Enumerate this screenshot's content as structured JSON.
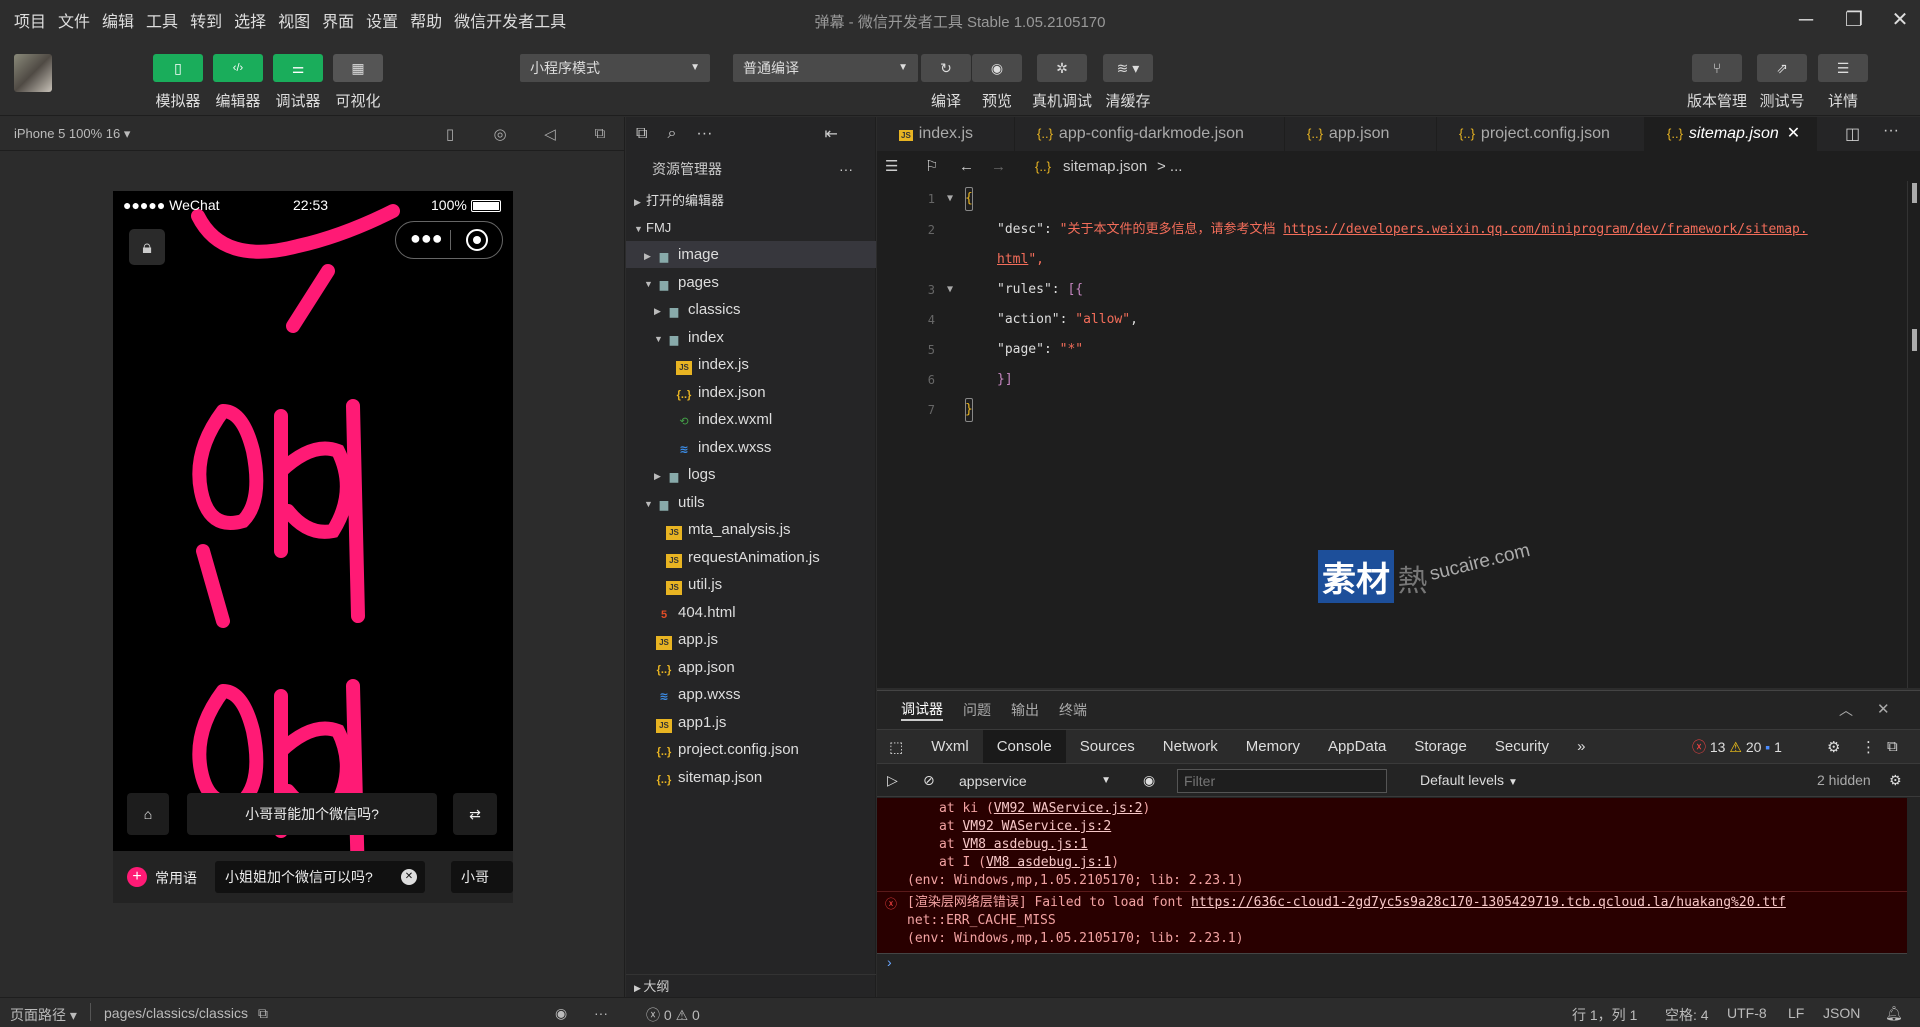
{
  "menubar": {
    "items": [
      "项目",
      "文件",
      "编辑",
      "工具",
      "转到",
      "选择",
      "视图",
      "界面",
      "设置",
      "帮助",
      "微信开发者工具"
    ],
    "window_title": "弹幕 - 微信开发者工具 Stable 1.05.2105170"
  },
  "toolbar": {
    "simulator_label": "模拟器",
    "editor_label": "编辑器",
    "debugger_label": "调试器",
    "visual_label": "可视化",
    "mode_select": "小程序模式",
    "compile_select": "普通编译",
    "compile_label": "编译",
    "preview_label": "预览",
    "remote_debug_label": "真机调试",
    "clear_cache_label": "清缓存",
    "version_label": "版本管理",
    "test_label": "测试号",
    "details_label": "详情"
  },
  "simulator": {
    "device": "iPhone 5 100% 16 ▾",
    "status_carrier": "●●●●● WeChat",
    "status_time": "22:53",
    "status_battery": "100%",
    "input_bar_text": "小哥哥能加个微信吗?",
    "quick_label": "常用语",
    "chip1": "小姐姐加个微信可以吗?",
    "chip2": "小哥",
    "danmaku_color": "#ff1a75"
  },
  "explorer": {
    "title": "资源管理器",
    "open_editors": "打开的编辑器",
    "project": "FMJ",
    "tree": [
      {
        "name": "image",
        "type": "folder",
        "depth": 1,
        "arrow": "▶"
      },
      {
        "name": "pages",
        "type": "folder",
        "depth": 1,
        "arrow": "▼"
      },
      {
        "name": "classics",
        "type": "folder",
        "depth": 2,
        "arrow": "▶"
      },
      {
        "name": "index",
        "type": "folder",
        "depth": 2,
        "arrow": "▼"
      },
      {
        "name": "index.js",
        "type": "js",
        "depth": 3,
        "arrow": ""
      },
      {
        "name": "index.json",
        "type": "json",
        "depth": 3,
        "arrow": ""
      },
      {
        "name": "index.wxml",
        "type": "wxml",
        "depth": 3,
        "arrow": ""
      },
      {
        "name": "index.wxss",
        "type": "wxss",
        "depth": 3,
        "arrow": ""
      },
      {
        "name": "logs",
        "type": "folder",
        "depth": 2,
        "arrow": "▶"
      },
      {
        "name": "utils",
        "type": "folder",
        "depth": 1,
        "arrow": "▼"
      },
      {
        "name": "mta_analysis.js",
        "type": "js",
        "depth": 2,
        "arrow": ""
      },
      {
        "name": "requestAnimation.js",
        "type": "js",
        "depth": 2,
        "arrow": ""
      },
      {
        "name": "util.js",
        "type": "js",
        "depth": 2,
        "arrow": ""
      },
      {
        "name": "404.html",
        "type": "html",
        "depth": 1,
        "arrow": ""
      },
      {
        "name": "app.js",
        "type": "js",
        "depth": 1,
        "arrow": ""
      },
      {
        "name": "app.json",
        "type": "json",
        "depth": 1,
        "arrow": ""
      },
      {
        "name": "app.wxss",
        "type": "wxss",
        "depth": 1,
        "arrow": ""
      },
      {
        "name": "app1.js",
        "type": "js",
        "depth": 1,
        "arrow": ""
      },
      {
        "name": "project.config.json",
        "type": "json",
        "depth": 1,
        "arrow": ""
      },
      {
        "name": "sitemap.json",
        "type": "json",
        "depth": 1,
        "arrow": ""
      }
    ],
    "outline": "大纲",
    "problems": "ⓧ 0 ⚠ 0"
  },
  "editor": {
    "tabs": [
      {
        "name": "index.js",
        "icon": "JS"
      },
      {
        "name": "app-config-darkmode.json",
        "icon": "{..}"
      },
      {
        "name": "app.json",
        "icon": "{..}"
      },
      {
        "name": "project.config.json",
        "icon": "{..}"
      },
      {
        "name": "sitemap.json",
        "icon": "{..}"
      }
    ],
    "breadcrumb_file": "sitemap.json",
    "breadcrumb_rest": "> ...",
    "lines": {
      "l1": "{",
      "l2_key": "\"desc\"",
      "l2_str": "\"关于本文件的更多信息，请参考文档 ",
      "l2_url": "https://developers.weixin.qq.com/miniprogram/dev/framework/sitemap.",
      "l2b_url": "html",
      "l2b_end": "\",",
      "l3_key": "\"rules\"",
      "l3_open": "[{",
      "l4_key": "\"action\"",
      "l4_val": "\"allow\"",
      "l5_key": "\"page\"",
      "l5_val": "\"*\"",
      "l6": "}]",
      "l7": "}"
    },
    "line_numbers": [
      "1",
      "2",
      "3",
      "4",
      "5",
      "6",
      "7"
    ]
  },
  "debugger": {
    "tabs": [
      "调试器",
      "问题",
      "输出",
      "终端"
    ],
    "devtools_tabs": [
      "Wxml",
      "Console",
      "Sources",
      "Network",
      "Memory",
      "AppData",
      "Storage",
      "Security"
    ],
    "errors": "13",
    "warnings": "20",
    "info": "1",
    "context": "appservice",
    "filter_placeholder": "Filter",
    "levels": "Default levels",
    "hidden": "2 hidden",
    "console": {
      "c1_pre": "at ki (",
      "c1_link": "VM92 WAService.js:2",
      "c1_post": ")",
      "c2_pre": "at ",
      "c2_link": "VM92 WAService.js:2",
      "c3_pre": "at ",
      "c3_link": "VM8 asdebug.js:1",
      "c4_pre": "at I (",
      "c4_link": "VM8 asdebug.js:1",
      "c4_post": ")",
      "c5": "(env: Windows,mp,1.05.2105170; lib: 2.23.1)",
      "c6_pre": "[渲染层网络层错误] Failed to load font ",
      "c6_link": "https://636c-cloud1-2gd7yc5s9a28c170-1305429719.tcb.qcloud.la/huakang%20.ttf",
      "c7": "net::ERR_CACHE_MISS",
      "c8": "(env: Windows,mp,1.05.2105170; lib: 2.23.1)"
    }
  },
  "statusbar": {
    "page_path_label": "页面路径 ▾",
    "page_path": "pages/classics/classics",
    "position": "行 1，列 1",
    "spaces": "空格: 4",
    "encoding": "UTF-8",
    "eol": "LF",
    "language": "JSON"
  },
  "watermark": {
    "text_cn": "素材",
    "text_extra": "熱",
    "text_en": "sucaire.com"
  }
}
